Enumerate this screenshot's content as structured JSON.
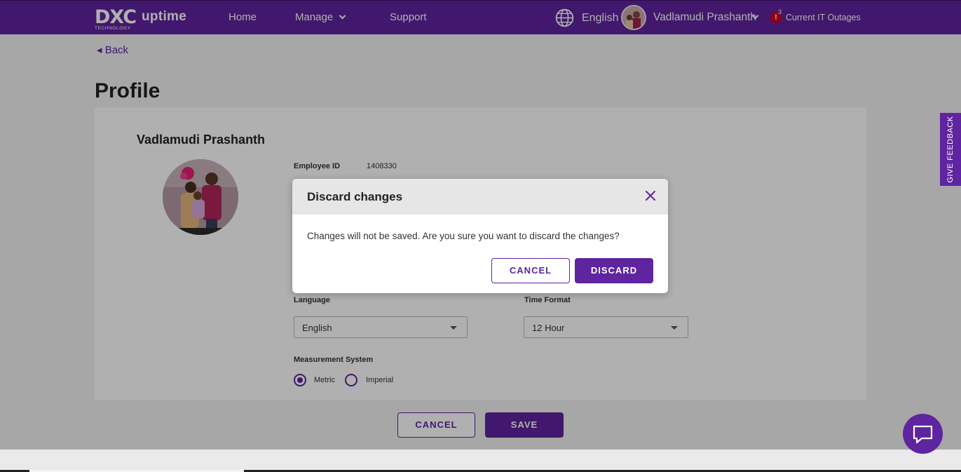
{
  "header": {
    "logo_main": "DXC",
    "logo_sub": "TECHNOLOGY",
    "app_name": "uptime",
    "nav": {
      "home": "Home",
      "manage": "Manage",
      "support": "Support"
    },
    "language": "English",
    "user_name": "Vadlamudi Prashanth",
    "alert_symbol": "!",
    "alert_count": "3",
    "outages_label": "Current IT Outages"
  },
  "page": {
    "back_label": "◂ Back",
    "title": "Profile",
    "profile_name": "Vadlamudi Prashanth",
    "employee_id_label": "Employee ID",
    "employee_id_value": "1408330",
    "language_label": "Language",
    "language_value": "English",
    "time_format_label": "Time Format",
    "time_format_value": "12 Hour",
    "measurement_label": "Measurement System",
    "measurement_options": [
      "Metric",
      "Imperial"
    ],
    "measurement_selected": "Metric",
    "cancel_label": "CANCEL",
    "save_label": "SAVE"
  },
  "feedback_label": "GIVE FEEDBACK",
  "modal": {
    "title": "Discard changes",
    "message": "Changes will not be saved. Are you sure you want to discard the changes?",
    "cancel_label": "CANCEL",
    "discard_label": "DISCARD"
  },
  "colors": {
    "brand_purple": "#5f249f",
    "overlay": "rgba(0,0,0,0.31)",
    "alert_red": "#d0021b"
  },
  "icons": [
    "globe-icon",
    "chevron-down-icon",
    "avatar",
    "alert-icon",
    "close-icon",
    "chat-icon"
  ]
}
